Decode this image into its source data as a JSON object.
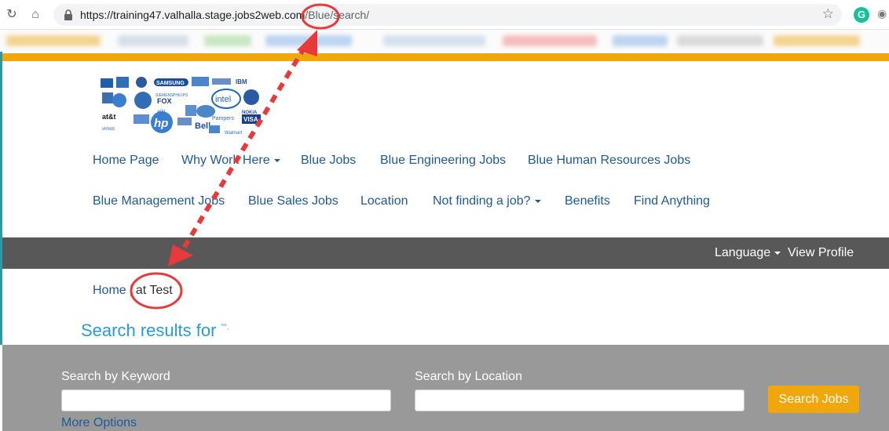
{
  "browser": {
    "url_host": "https://training47.valhalla.stage.jobs2web.com",
    "url_path": "/Blue/search/",
    "extension_badge": "G"
  },
  "nav": {
    "row1": [
      {
        "label": "Home Page",
        "dropdown": false
      },
      {
        "label": "Why Work Here",
        "dropdown": true
      },
      {
        "label": "Blue Jobs",
        "dropdown": false
      },
      {
        "label": "Blue Engineering Jobs",
        "dropdown": false
      },
      {
        "label": "Blue Human Resources Jobs",
        "dropdown": false
      }
    ],
    "row2": [
      {
        "label": "Blue Management Jobs",
        "dropdown": false
      },
      {
        "label": "Blue Sales Jobs",
        "dropdown": false
      },
      {
        "label": "Location",
        "dropdown": false
      },
      {
        "label": "Not finding a job?",
        "dropdown": true
      },
      {
        "label": "Benefits",
        "dropdown": false
      },
      {
        "label": "Find Anything",
        "dropdown": false
      }
    ]
  },
  "logo_brands": [
    "SAMSUNG",
    "intel",
    "FOX",
    "hp",
    "at&t",
    "Bell",
    "VISA",
    "Walmart",
    "Pampers",
    "IBM",
    "NOKIA",
    "vimeo",
    "flickr",
    "PHILIPS",
    "SIEMENS"
  ],
  "utility": {
    "language_label": "Language",
    "view_profile_label": "View Profile"
  },
  "breadcrumb": {
    "home": "Home",
    "separator": "|",
    "current": "at Test"
  },
  "results": {
    "title": "Search results for",
    "query_mark": "\"\".",
    "suffix": "."
  },
  "search": {
    "keyword_label": "Search by Keyword",
    "keyword_value": "",
    "location_label": "Search by Location",
    "location_value": "",
    "button_label": "Search Jobs",
    "more_options_label": "More Options"
  },
  "colors": {
    "accent_gold": "#f0a70b",
    "nav_link": "#1d5a96",
    "results_title": "#2a9bd6",
    "utility_bar": "#585858",
    "search_panel": "#999999",
    "annotation_red": "#e83a3a"
  }
}
